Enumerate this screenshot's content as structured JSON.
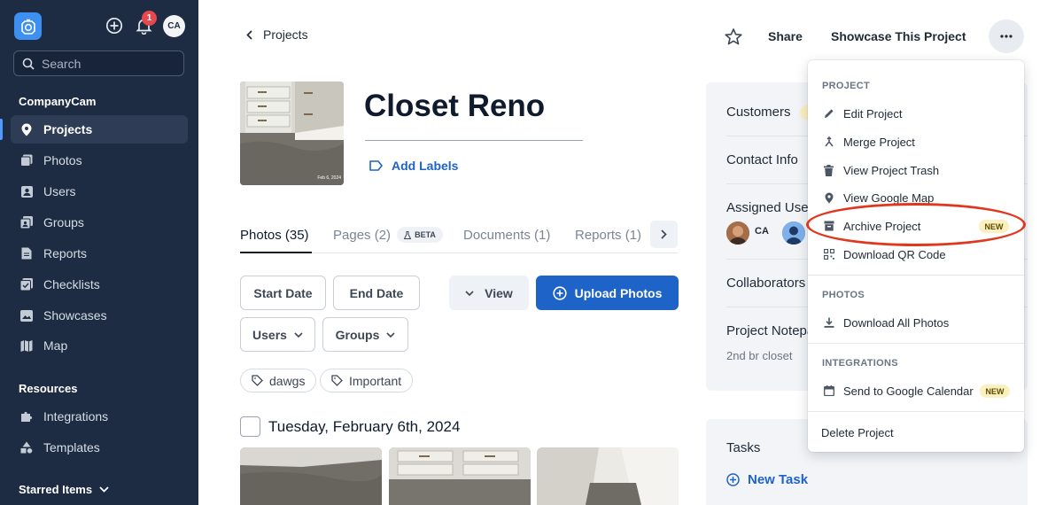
{
  "sidebar": {
    "search_placeholder": "Search",
    "notification_count": "1",
    "user_initials": "CA",
    "section_company": "CompanyCam",
    "items": [
      {
        "label": "Projects"
      },
      {
        "label": "Photos"
      },
      {
        "label": "Users"
      },
      {
        "label": "Groups"
      },
      {
        "label": "Reports"
      },
      {
        "label": "Checklists"
      },
      {
        "label": "Showcases"
      },
      {
        "label": "Map"
      }
    ],
    "section_resources": "Resources",
    "resources": [
      {
        "label": "Integrations"
      },
      {
        "label": "Templates"
      }
    ],
    "starred": "Starred Items"
  },
  "header": {
    "back_label": "Projects",
    "share_label": "Share",
    "showcase_label": "Showcase This Project"
  },
  "project": {
    "title": "Closet Reno",
    "add_labels": "Add Labels",
    "thumb_stamp": "Feb 6, 2024"
  },
  "tabs": [
    {
      "label": "Photos (35)"
    },
    {
      "label": "Pages (2)"
    },
    {
      "label": "Documents (1)"
    },
    {
      "label": "Reports (1)"
    }
  ],
  "beta_badge": "BETA",
  "filters": {
    "start_date": "Start Date",
    "end_date": "End Date",
    "users": "Users",
    "groups": "Groups",
    "view": "View",
    "upload": "Upload Photos"
  },
  "tags": [
    "dawgs",
    "Important"
  ],
  "date_heading": "Tuesday, February 6th, 2024",
  "info": {
    "customers": "Customers",
    "contact_info": "Contact Info",
    "assigned_users": "Assigned Users",
    "assigned_initials": "CA",
    "collaborators": "Collaborators",
    "notepad": "Project Notepad",
    "notepad_text": "2nd br closet",
    "tasks": "Tasks",
    "new_task": "New Task"
  },
  "menu": {
    "heading_project": "PROJECT",
    "edit": "Edit Project",
    "merge": "Merge Project",
    "trash": "View Project Trash",
    "map": "View Google Map",
    "archive": "Archive Project",
    "qr": "Download QR Code",
    "heading_photos": "PHOTOS",
    "download_all": "Download All Photos",
    "heading_integrations": "INTEGRATIONS",
    "calendar": "Send to Google Calendar",
    "delete": "Delete Project",
    "new_badge": "NEW"
  },
  "colors": {
    "sidebar_bg": "#1d2c42",
    "accent_blue": "#1e63c7",
    "logo_blue": "#3d8ff0",
    "badge_red": "#e5484d",
    "highlight_red": "#e0381f",
    "new_badge_bg": "#fbf0bf"
  }
}
